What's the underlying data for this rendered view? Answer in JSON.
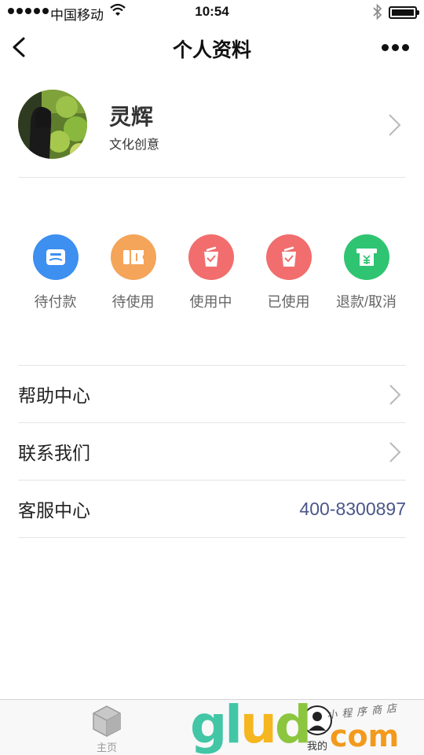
{
  "status_bar": {
    "carrier": "中国移动",
    "time": "10:54"
  },
  "nav": {
    "title": "个人资料"
  },
  "profile": {
    "name": "灵辉",
    "subtitle": "文化创意"
  },
  "orders": [
    {
      "label": "待付款",
      "color": "#3d8ff0",
      "icon": "wallet-icon"
    },
    {
      "label": "待使用",
      "color": "#f4a55a",
      "icon": "ticket-icon"
    },
    {
      "label": "使用中",
      "color": "#f26d6d",
      "icon": "bag-check-icon"
    },
    {
      "label": "已使用",
      "color": "#f26d6d",
      "icon": "bag-check-icon"
    },
    {
      "label": "退款/取消",
      "color": "#2fc471",
      "icon": "refund-icon"
    }
  ],
  "menu": {
    "help": "帮助中心",
    "contact": "联系我们",
    "service": "客服中心",
    "service_phone": "400-8300897"
  },
  "tabbar": {
    "home": "主页",
    "mine": "我的"
  },
  "watermark": {
    "brand_letters": [
      "g",
      "l",
      "u",
      "d"
    ],
    "brand_suffix": "com",
    "tagline": "小程序商店",
    "colors": [
      "#43c6a6",
      "#43c6a6",
      "#f5b61f",
      "#8cc63f"
    ]
  }
}
